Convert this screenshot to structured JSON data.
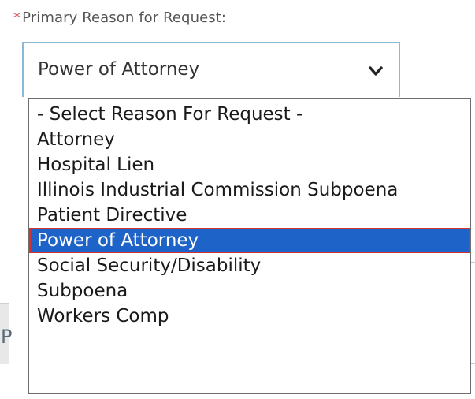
{
  "field": {
    "required_marker": "*",
    "label": "Primary Reason for Request:"
  },
  "select": {
    "current_value": "Power of Attorney",
    "chevron_icon": "chevron-down-icon"
  },
  "options": [
    "- Select Reason For Request -",
    "Attorney",
    "Hospital Lien",
    "Illinois Industrial Commission Subpoena",
    "Patient Directive",
    "Power of Attorney",
    "Social Security/Disability",
    "Subpoena",
    "Workers Comp"
  ],
  "highlighted_option": "Power of Attorney",
  "background": {
    "partial_heading_letter": "P"
  },
  "colors": {
    "required_star": "#d9534f",
    "select_border": "#8cb8d8",
    "highlight_bg": "#1e64c8",
    "highlight_outline": "#d23232"
  }
}
